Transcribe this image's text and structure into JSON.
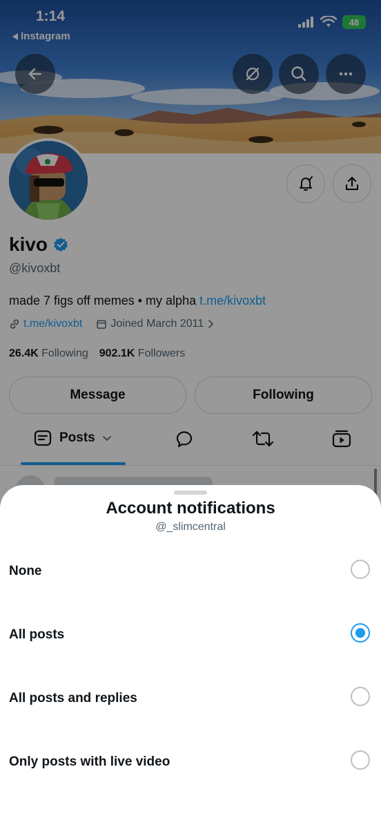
{
  "status_bar": {
    "time": "1:14",
    "back_app": "Instagram",
    "battery": "48"
  },
  "banner_buttons": {
    "back_icon": "arrow-left-icon",
    "grok_icon": "slashed-circle-icon",
    "search_icon": "search-icon",
    "more_icon": "more-horizontal-icon"
  },
  "profile": {
    "display_name": "kivo",
    "verified": true,
    "handle": "@kivoxbt",
    "bio_text": "made 7 figs off memes • my alpha ",
    "bio_link": "t.me/kivoxbt",
    "website": "t.me/kivoxbt",
    "joined": "Joined March 2011",
    "following_count": "26.4K",
    "following_label": "Following",
    "followers_count": "902.1K",
    "followers_label": "Followers",
    "message_button": "Message",
    "following_button": "Following"
  },
  "tabs": {
    "posts": "Posts",
    "icons": [
      "posts-icon",
      "replies-icon",
      "retweet-icon",
      "video-icon"
    ]
  },
  "sheet": {
    "title": "Account notifications",
    "subtitle": "@_slimcentral",
    "options": [
      {
        "label": "None",
        "selected": false
      },
      {
        "label": "All posts",
        "selected": true
      },
      {
        "label": "All posts and replies",
        "selected": false
      },
      {
        "label": "Only posts with live video",
        "selected": false
      }
    ]
  },
  "colors": {
    "accent": "#1d9bf0",
    "text_primary": "#0f1419",
    "text_secondary": "#536471",
    "battery": "#34c759"
  }
}
